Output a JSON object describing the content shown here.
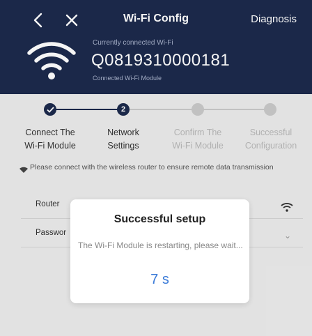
{
  "header": {
    "title": "Wi-Fi Config",
    "diagnosis_label": "Diagnosis",
    "back_icon": "chevron-left-icon",
    "close_icon": "close-icon",
    "connected_caption": "Currently connected Wi-Fi",
    "connected_id": "Q0819310000181",
    "connected_sub": "Connected Wi-Fi Module"
  },
  "steps": [
    {
      "line1": "Connect The",
      "line2": "Wi-Fi Module",
      "status": "done"
    },
    {
      "line1": "Network",
      "line2": "Settings",
      "status": "current",
      "number": "2"
    },
    {
      "line1": "Confirm The",
      "line2": "Wi-Fi Module",
      "status": "pending"
    },
    {
      "line1": "Successful",
      "line2": "Configuration",
      "status": "pending"
    }
  ],
  "notice": {
    "text": "Please connect with the wireless router to ensure remote data transmission"
  },
  "form": {
    "router_label": "Router",
    "password_label": "Passwor"
  },
  "dialog": {
    "title": "Successful setup",
    "message": "The Wi-Fi Module is restarting, please wait...",
    "countdown": "7 s"
  },
  "colors": {
    "header_bg": "#1d2a4c",
    "step_active": "#1d2a4c",
    "step_inactive": "#c9c9c9",
    "accent_blue": "#3b7bd8"
  }
}
